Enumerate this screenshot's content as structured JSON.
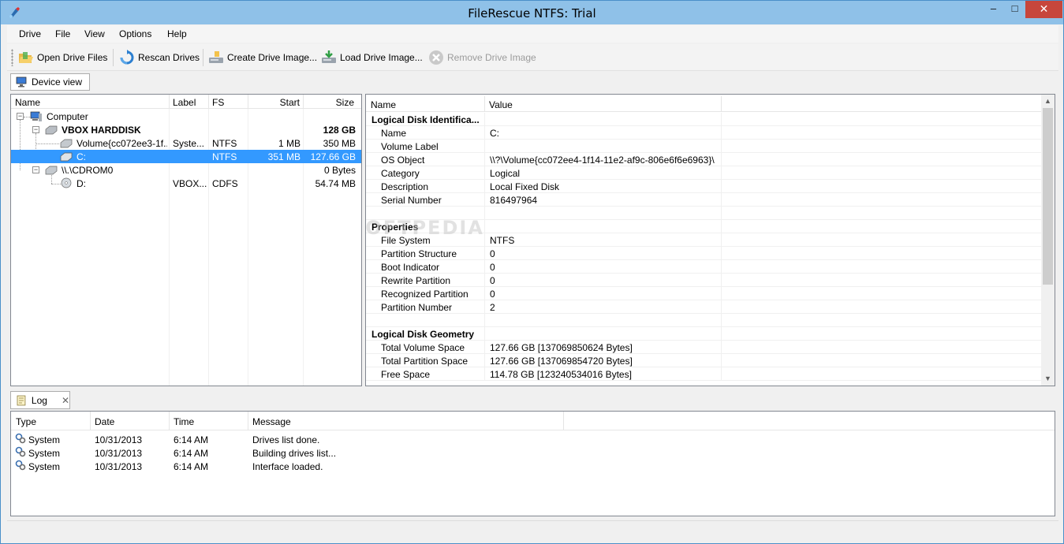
{
  "window": {
    "title": "FileRescue NTFS: Trial",
    "min": "–",
    "max": "□",
    "close": "✕"
  },
  "menu": [
    "Drive",
    "File",
    "View",
    "Options",
    "Help"
  ],
  "toolbar": {
    "open_drive_files": "Open Drive Files",
    "rescan_drives": "Rescan Drives",
    "create_drive_image": "Create Drive Image...",
    "load_drive_image": "Load Drive Image...",
    "remove_drive_image": "Remove Drive Image"
  },
  "device_view": {
    "tab_label": "Device view",
    "columns": [
      "Name",
      "Label",
      "FS",
      "Start",
      "Size"
    ],
    "rows": [
      {
        "name": "Computer",
        "label": "",
        "fs": "",
        "start": "",
        "size": ""
      },
      {
        "name": "VBOX HARDDISK",
        "label": "",
        "fs": "",
        "start": "",
        "size": "128 GB"
      },
      {
        "name": "Volume{cc072ee3-1f...",
        "label": "Syste...",
        "fs": "NTFS",
        "start": "1 MB",
        "size": "350 MB"
      },
      {
        "name": "C:",
        "label": "",
        "fs": "NTFS",
        "start": "351 MB",
        "size": "127.66 GB"
      },
      {
        "name": "\\\\.\\CDROM0",
        "label": "",
        "fs": "",
        "start": "",
        "size": "0 Bytes"
      },
      {
        "name": "D:",
        "label": "VBOX...",
        "fs": "CDFS",
        "start": "",
        "size": "54.74 MB"
      }
    ]
  },
  "properties": {
    "columns": [
      "Name",
      "Value"
    ],
    "rows": [
      {
        "kind": "group",
        "name": "Logical Disk Identifica...",
        "value": ""
      },
      {
        "kind": "item",
        "name": "Name",
        "value": "C:"
      },
      {
        "kind": "item",
        "name": "Volume Label",
        "value": ""
      },
      {
        "kind": "item",
        "name": "OS Object",
        "value": "\\\\?\\Volume{cc072ee4-1f14-11e2-af9c-806e6f6e6963}\\"
      },
      {
        "kind": "item",
        "name": "Category",
        "value": "Logical"
      },
      {
        "kind": "item",
        "name": "Description",
        "value": "Local Fixed Disk"
      },
      {
        "kind": "item",
        "name": "Serial Number",
        "value": "816497964"
      },
      {
        "kind": "blank",
        "name": "",
        "value": ""
      },
      {
        "kind": "group",
        "name": "Properties",
        "value": ""
      },
      {
        "kind": "item",
        "name": "File System",
        "value": "NTFS"
      },
      {
        "kind": "item",
        "name": "Partition Structure",
        "value": "0"
      },
      {
        "kind": "item",
        "name": "Boot Indicator",
        "value": "0"
      },
      {
        "kind": "item",
        "name": "Rewrite Partition",
        "value": "0"
      },
      {
        "kind": "item",
        "name": "Recognized Partition",
        "value": "0"
      },
      {
        "kind": "item",
        "name": "Partition Number",
        "value": "2"
      },
      {
        "kind": "blank",
        "name": "",
        "value": ""
      },
      {
        "kind": "group",
        "name": "Logical Disk Geometry",
        "value": ""
      },
      {
        "kind": "item",
        "name": "Total Volume Space",
        "value": "127.66 GB [137069850624 Bytes]"
      },
      {
        "kind": "item",
        "name": "Total Partition Space",
        "value": "127.66 GB [137069854720 Bytes]"
      },
      {
        "kind": "item",
        "name": "Free Space",
        "value": "114.78 GB [123240534016 Bytes]"
      }
    ]
  },
  "log": {
    "tab_label": "Log",
    "tab_close": "✕",
    "columns": [
      "Type",
      "Date",
      "Time",
      "Message"
    ],
    "rows": [
      {
        "type": "System",
        "date": "10/31/2013",
        "time": "6:14 AM",
        "message": "Drives list done."
      },
      {
        "type": "System",
        "date": "10/31/2013",
        "time": "6:14 AM",
        "message": "Building drives list..."
      },
      {
        "type": "System",
        "date": "10/31/2013",
        "time": "6:14 AM",
        "message": "Interface loaded."
      }
    ]
  },
  "watermark": "SOFTPEDIA",
  "colors": {
    "title_bar": "#8fc1e8",
    "selection": "#3399ff",
    "close_button": "#c7463c"
  }
}
